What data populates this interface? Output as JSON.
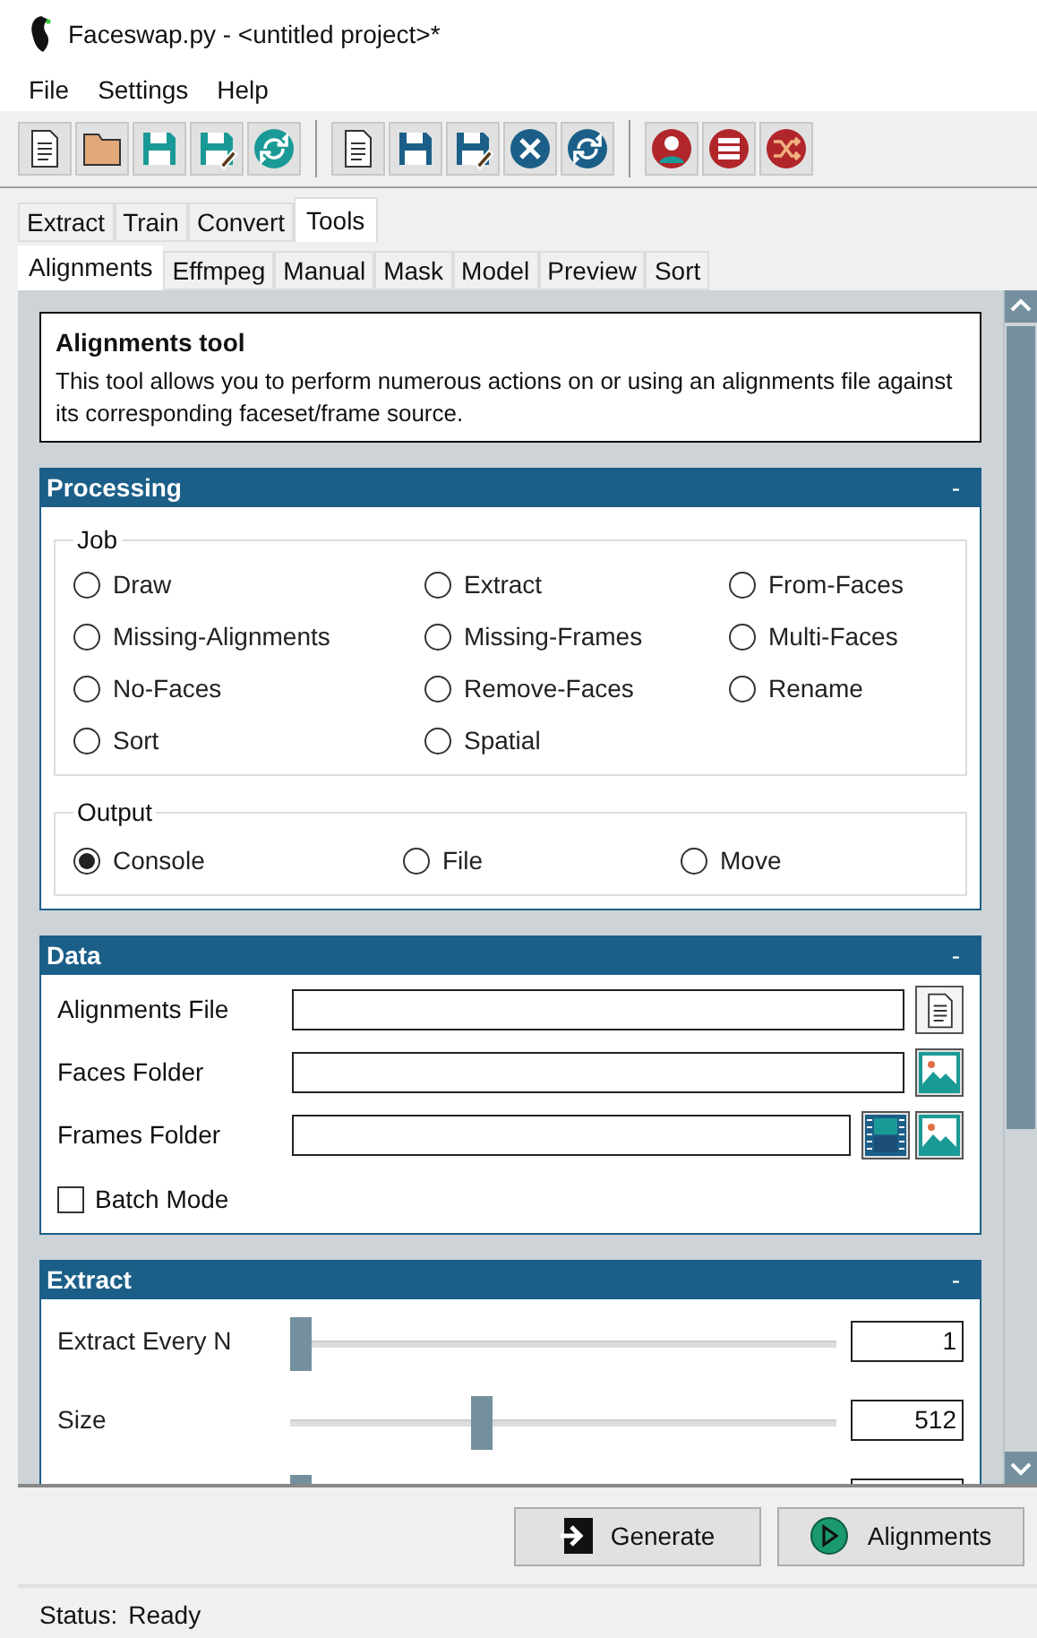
{
  "window": {
    "title": "Faceswap.py - <untitled project>*"
  },
  "menu": [
    "File",
    "Settings",
    "Help"
  ],
  "tabs": [
    {
      "label": "Extract",
      "selected": false
    },
    {
      "label": "Train",
      "selected": false
    },
    {
      "label": "Convert",
      "selected": false
    },
    {
      "label": "Tools",
      "selected": true
    }
  ],
  "subtabs": [
    {
      "label": "Alignments",
      "selected": true
    },
    {
      "label": "Effmpeg",
      "selected": false
    },
    {
      "label": "Manual",
      "selected": false
    },
    {
      "label": "Mask",
      "selected": false
    },
    {
      "label": "Model",
      "selected": false
    },
    {
      "label": "Preview",
      "selected": false
    },
    {
      "label": "Sort",
      "selected": false
    }
  ],
  "description": {
    "title": "Alignments tool",
    "text": "This tool allows you to perform numerous actions on or using an alignments file against its corresponding faceset/frame source."
  },
  "processing": {
    "title": "Processing",
    "collapse": "-",
    "job": {
      "label": "Job",
      "options": [
        {
          "label": "Draw",
          "selected": false
        },
        {
          "label": "Extract",
          "selected": false
        },
        {
          "label": "From-Faces",
          "selected": false
        },
        {
          "label": "Missing-Alignments",
          "selected": false
        },
        {
          "label": "Missing-Frames",
          "selected": false
        },
        {
          "label": "Multi-Faces",
          "selected": false
        },
        {
          "label": "No-Faces",
          "selected": false
        },
        {
          "label": "Remove-Faces",
          "selected": false
        },
        {
          "label": "Rename",
          "selected": false
        },
        {
          "label": "Sort",
          "selected": false
        },
        {
          "label": "Spatial",
          "selected": false
        }
      ]
    },
    "output": {
      "label": "Output",
      "options": [
        {
          "label": "Console",
          "selected": true
        },
        {
          "label": "File",
          "selected": false
        },
        {
          "label": "Move",
          "selected": false
        }
      ]
    }
  },
  "data": {
    "title": "Data",
    "collapse": "-",
    "fields": [
      {
        "label": "Alignments File",
        "kind": "file"
      },
      {
        "label": "Faces Folder",
        "kind": "folder"
      },
      {
        "label": "Frames Folder",
        "kind": "video_folder"
      }
    ],
    "batch_mode": {
      "label": "Batch Mode",
      "checked": false
    }
  },
  "extract": {
    "title": "Extract",
    "collapse": "-",
    "sliders": [
      {
        "label": "Extract Every N",
        "level": 0,
        "value": "1"
      },
      {
        "label": "Size",
        "level": 0.34,
        "value": "512"
      },
      {
        "level": 0
      }
    ]
  },
  "buttons": [
    {
      "label": "Generate",
      "kind": "generate"
    },
    {
      "label": "Alignments",
      "kind": "run"
    }
  ],
  "status_bar": {
    "label": "Status:",
    "value": "Ready"
  }
}
